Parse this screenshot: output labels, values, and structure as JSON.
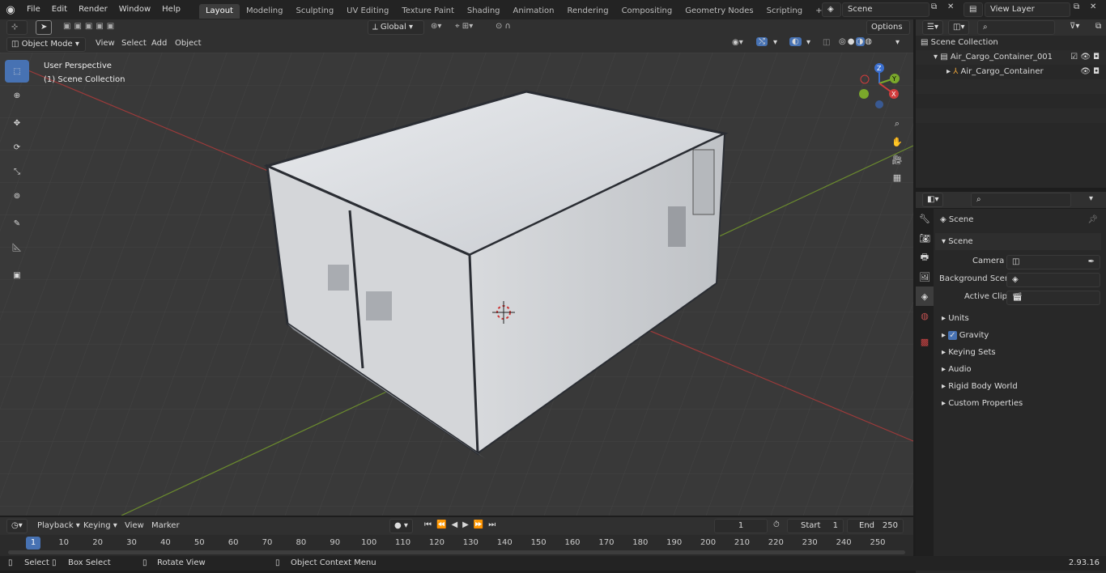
{
  "menus": [
    "File",
    "Edit",
    "Render",
    "Window",
    "Help"
  ],
  "workspaces": [
    "Layout",
    "Modeling",
    "Sculpting",
    "UV Editing",
    "Texture Paint",
    "Shading",
    "Animation",
    "Rendering",
    "Compositing",
    "Geometry Nodes",
    "Scripting"
  ],
  "scene_field": "Scene",
  "view_layer_field": "View Layer",
  "header": {
    "transform": "Global",
    "options": "Options",
    "mode": "Object Mode",
    "menus": [
      "View",
      "Select",
      "Add",
      "Object"
    ]
  },
  "viewport": {
    "perspective": "User Perspective",
    "collection": "(1) Scene Collection"
  },
  "outliner": {
    "root": "Scene Collection",
    "items": [
      "Air_Cargo_Container_001",
      "Air_Cargo_Container"
    ]
  },
  "props": {
    "scene_title": "Scene",
    "section": "Scene",
    "camera_label": "Camera",
    "bg_label": "Background Scene",
    "clip_label": "Active Clip",
    "panels": [
      "Units",
      "Gravity",
      "Keying Sets",
      "Audio",
      "Rigid Body World",
      "Custom Properties"
    ]
  },
  "timeline": {
    "menus": [
      "Playback",
      "Keying",
      "View",
      "Marker"
    ],
    "frame": "1",
    "start_label": "Start",
    "start": "1",
    "end_label": "End",
    "end": "250",
    "ticks": [
      "1",
      "10",
      "20",
      "30",
      "40",
      "50",
      "60",
      "70",
      "80",
      "90",
      "100",
      "110",
      "120",
      "130",
      "140",
      "150",
      "160",
      "170",
      "180",
      "190",
      "200",
      "210",
      "220",
      "230",
      "240",
      "250"
    ]
  },
  "status": {
    "select": "Select",
    "box": "Box Select",
    "rotate": "Rotate View",
    "context": "Object Context Menu",
    "version": "2.93.16"
  }
}
